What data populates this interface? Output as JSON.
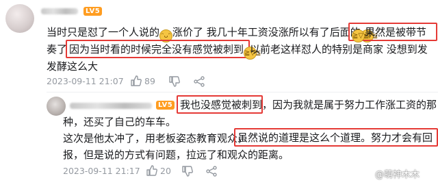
{
  "comment": {
    "level": "LV5",
    "line1_a": "当时只是怼了一个人说的",
    "line1_b": "涨价了 我几十年工资没涨所以有了后面的",
    "line1_c": "果然是被带节",
    "line2_a": "奏了",
    "line2_b": "因为当时看的时候完全没有感觉被刺到",
    "line2_c": "以前老这样怼人的特别是商家 没想到发",
    "line3": "发酵这么大",
    "time": "2023-09-11 21:07",
    "likes": "89"
  },
  "reply": {
    "level": "LV5",
    "line1_a": "我也没感觉被刺到",
    "line1_b": "，因为我就是属于努力工作涨工资的那",
    "line2": "种，还买了自己的车车。",
    "line3_a": "这次是他太冲了，用老板姿态教育观众，",
    "line3_b": "虽然说的道理是这么个道理。努力才会有回",
    "line4": "报，但是说的方式有问题，拉远了和观众的距离。",
    "time": "2023-09-11 21:17",
    "likes": "20"
  },
  "icons": [
    "emoji-smile-icon",
    "emoji-laugh-cry-icon",
    "thumb-up-icon",
    "thumb-down-icon",
    "share-icon"
  ],
  "watermark": "@萌神木木",
  "colors": {
    "level_badge": "#ff9d21",
    "highlight": "#e53935",
    "meta": "#9499a0"
  }
}
